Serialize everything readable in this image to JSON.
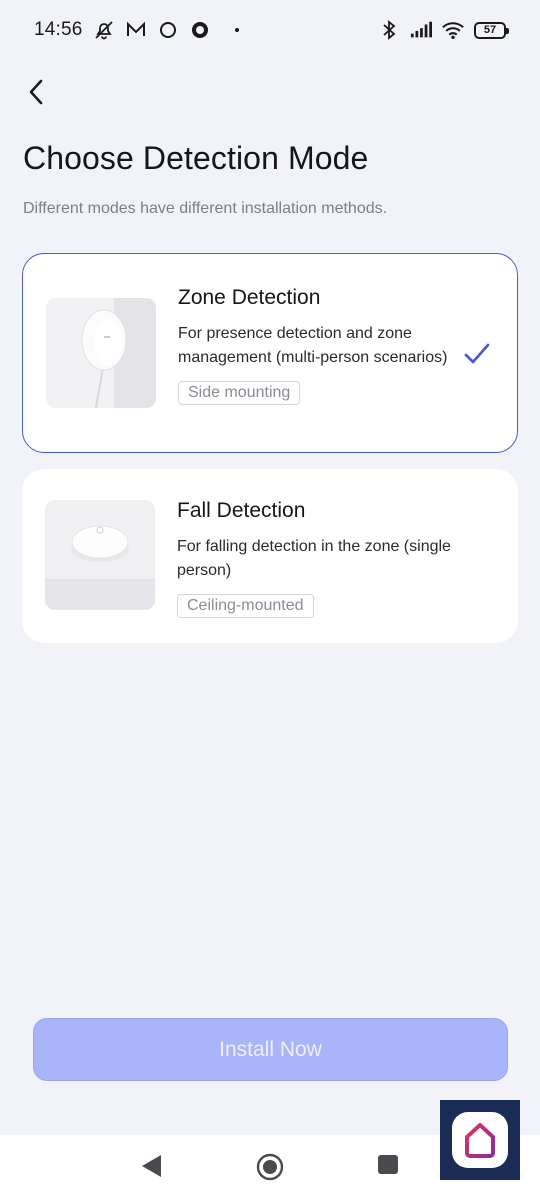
{
  "status_bar": {
    "time": "14:56",
    "battery": "57",
    "icons_left": [
      "muted-alarm-icon",
      "mail-icon",
      "circle-icon",
      "ring-icon",
      "dot-icon"
    ],
    "icons_right": [
      "bluetooth-icon",
      "signal-icon",
      "wifi-icon",
      "battery-icon"
    ]
  },
  "header": {
    "title": "Choose Detection Mode",
    "subtitle": "Different modes have different installation methods."
  },
  "modes": [
    {
      "title": "Zone Detection",
      "description": "For presence detection and zone management (multi-person scenarios)",
      "tag": "Side mounting",
      "selected": true
    },
    {
      "title": "Fall Detection",
      "description": "For falling detection in the zone (single person)",
      "tag": "Ceiling-mounted",
      "selected": false
    }
  ],
  "install_button": {
    "label": "Install Now",
    "enabled": false
  },
  "colors": {
    "accent": "#4b5bd0",
    "button_disabled": "#aab4f8",
    "background": "#f1f3f8",
    "card": "#ffffff"
  }
}
